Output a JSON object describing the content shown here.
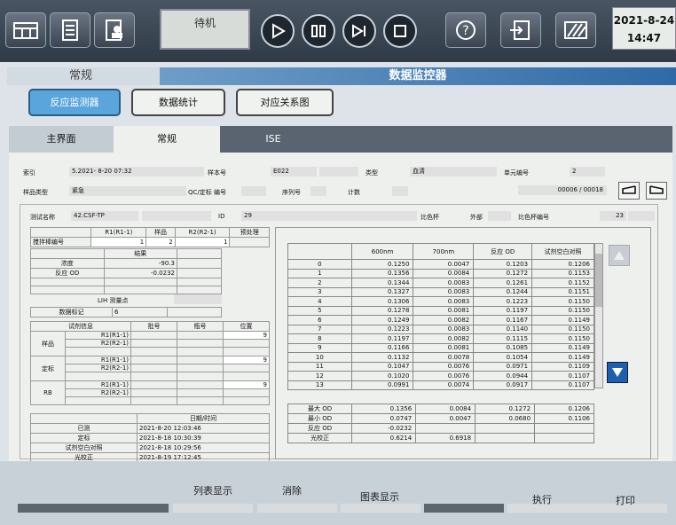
{
  "topbar": {
    "status_text": "待机",
    "clock": {
      "date": "2021-8-24",
      "time": "14:47"
    }
  },
  "header": {
    "left_title": "常规",
    "right_title": "数据监控器"
  },
  "nav": {
    "reaction": "反应监测器",
    "stats": "数据统计",
    "relation": "对应关系图"
  },
  "tabs": {
    "main": "主界面",
    "normal": "常规",
    "ise": "ISE"
  },
  "info": {
    "index_label": "索引",
    "index_value": "5.2021- 8-20 07:32",
    "sample_no_label": "样本号",
    "sample_no_value": "E022",
    "type_label": "类型",
    "type_value": "血清",
    "unit_label": "单元编号",
    "unit_value": "2",
    "sample_type_label": "样品类型",
    "sample_type_value": "紧急",
    "qc_label": "QC/定标 编号",
    "seq_label": "序列号",
    "count_label": "计数",
    "page_counter": "00006 / 00018"
  },
  "test": {
    "name_label": "测试名称",
    "name_value": "42.CSF-TP",
    "id_label": "ID",
    "id_value": "29",
    "cuvette_label": "比色杯",
    "external_label": "外部",
    "cuvette_no_label": "比色杯编号",
    "cuvette_no_value": "23"
  },
  "reagent_tbl": {
    "headers": [
      "",
      "R1(R1-1)",
      "样品",
      "R2(R2-1)",
      "预处理"
    ],
    "row_label": "搅拌棒编号",
    "values": [
      "1",
      "2",
      "1",
      ""
    ]
  },
  "result_tbl": {
    "header": "结果",
    "rows": [
      [
        "浓度",
        "-90.3"
      ],
      [
        "反应 OD",
        "-0.0232"
      ],
      [
        "",
        ""
      ],
      [
        "",
        ""
      ]
    ]
  },
  "lih_label": "LIH 测量点",
  "data_flag": {
    "label": "数据标记",
    "value": "6"
  },
  "reagent_info": {
    "headers": [
      "试剂信息",
      "批号",
      "瓶号",
      "位置"
    ],
    "groups": [
      {
        "name": "样品",
        "r1": "R1(R1-1)",
        "r2": "R2(R2-1)",
        "pos": "9"
      },
      {
        "name": "定标",
        "r1": "R1(R1-1)",
        "r2": "R2(R2-1)",
        "pos": "9"
      },
      {
        "name": "RB",
        "r1": "R1(R1-1)",
        "r2": "R2(R2-1)",
        "pos": "9"
      }
    ]
  },
  "datetime_tbl": {
    "header": "日期/时间",
    "rows": [
      [
        "已测",
        "2021-8-20 12:03:46"
      ],
      [
        "定标",
        "2021-8-18 10:30:39"
      ],
      [
        "试剂空白对照",
        "2021-8-18 10:29:56"
      ],
      [
        "光校正",
        "2021-8-19 17:12:45"
      ]
    ]
  },
  "monitor_tbl": {
    "headers": [
      "",
      "600nm",
      "700nm",
      "反应 OD",
      "试剂空白对照"
    ],
    "rows": [
      [
        "0",
        "0.1250",
        "0.0047",
        "0.1203",
        "0.1206"
      ],
      [
        "1",
        "0.1356",
        "0.0084",
        "0.1272",
        "0.1153"
      ],
      [
        "2",
        "0.1344",
        "0.0083",
        "0.1261",
        "0.1152"
      ],
      [
        "3",
        "0.1327",
        "0.0083",
        "0.1244",
        "0.1151"
      ],
      [
        "4",
        "0.1306",
        "0.0083",
        "0.1223",
        "0.1150"
      ],
      [
        "5",
        "0.1278",
        "0.0081",
        "0.1197",
        "0.1150"
      ],
      [
        "6",
        "0.1249",
        "0.0082",
        "0.1167",
        "0.1149"
      ],
      [
        "7",
        "0.1223",
        "0.0083",
        "0.1140",
        "0.1150"
      ],
      [
        "8",
        "0.1197",
        "0.0082",
        "0.1115",
        "0.1150"
      ],
      [
        "9",
        "0.1166",
        "0.0081",
        "0.1085",
        "0.1149"
      ],
      [
        "10",
        "0.1132",
        "0.0078",
        "0.1054",
        "0.1149"
      ],
      [
        "11",
        "0.1047",
        "0.0076",
        "0.0971",
        "0.1109"
      ],
      [
        "12",
        "0.1020",
        "0.0076",
        "0.0944",
        "0.1107"
      ],
      [
        "13",
        "0.0991",
        "0.0074",
        "0.0917",
        "0.1107"
      ]
    ]
  },
  "stat_tbl": {
    "rows": [
      [
        "最大 OD",
        "0.1356",
        "0.0084",
        "0.1272",
        "0.1206"
      ],
      [
        "最小 OD",
        "0.0747",
        "0.0047",
        "0.0680",
        "0.1106"
      ],
      [
        "反应 OD",
        "-0.0232",
        "",
        "",
        ""
      ],
      [
        "光校正",
        "0.6214",
        "0.6918",
        "",
        ""
      ]
    ]
  },
  "footer": {
    "list": "列表显示",
    "clear": "消除",
    "graph": "图表显示",
    "run": "执行",
    "print": "打印"
  }
}
